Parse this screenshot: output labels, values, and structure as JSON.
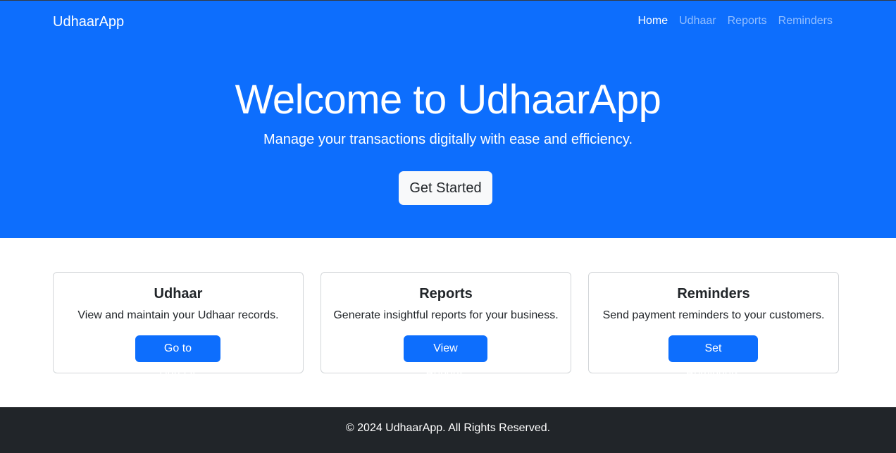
{
  "navbar": {
    "brand": "UdhaarApp",
    "links": [
      {
        "label": "Home",
        "active": true
      },
      {
        "label": "Udhaar",
        "active": false
      },
      {
        "label": "Reports",
        "active": false
      },
      {
        "label": "Reminders",
        "active": false
      }
    ]
  },
  "hero": {
    "title": "Welcome to UdhaarApp",
    "subtitle": "Manage your transactions digitally with ease and efficiency.",
    "button_label": "Get Started"
  },
  "cards": [
    {
      "title": "Udhaar",
      "text": "View and maintain your Udhaar records.",
      "button_label": "Go to Udhaar"
    },
    {
      "title": "Reports",
      "text": "Generate insightful reports for your business.",
      "button_label": "View Reports"
    },
    {
      "title": "Reminders",
      "text": "Send payment reminders to your customers.",
      "button_label": "Set Reminders"
    }
  ],
  "footer": {
    "text": "© 2024 UdhaarApp. All Rights Reserved."
  },
  "colors": {
    "primary": "#0d6efd",
    "light": "#f8f9fa",
    "dark": "#212529"
  }
}
